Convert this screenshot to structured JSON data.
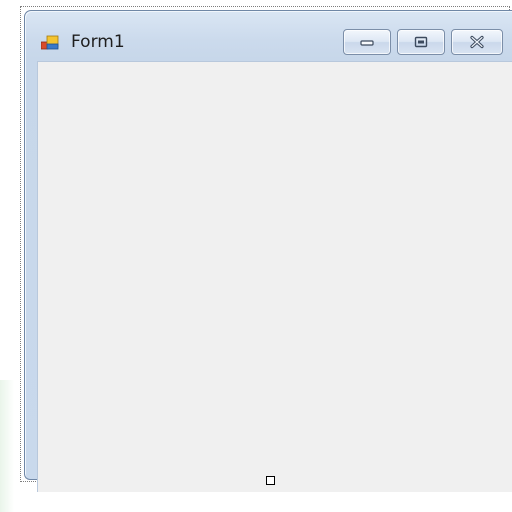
{
  "window": {
    "title": "Form1",
    "icon": "form-app-icon"
  },
  "caption_buttons": {
    "minimize_icon": "minimize-icon",
    "maximize_icon": "maximize-icon",
    "close_icon": "close-icon"
  },
  "colors": {
    "titlebar": "#c9d9ec",
    "client_area": "#f0f0f0",
    "window_border": "#6f87a6"
  }
}
